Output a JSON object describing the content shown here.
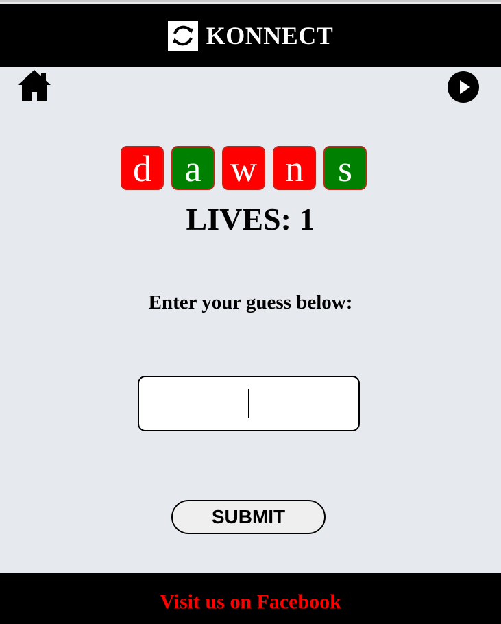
{
  "header": {
    "logo_icon": "refresh-arrows-icon",
    "title": "KONNECT"
  },
  "nav": {
    "home_icon": "home-icon",
    "play_icon": "play-circle-icon"
  },
  "game": {
    "letters": [
      {
        "char": "d",
        "status": "wrong",
        "color": "#ff0000"
      },
      {
        "char": "a",
        "status": "right",
        "color": "#008000"
      },
      {
        "char": "w",
        "status": "wrong",
        "color": "#ff0000"
      },
      {
        "char": "n",
        "status": "wrong",
        "color": "#ff0000"
      },
      {
        "char": "s",
        "status": "right",
        "color": "#008000"
      }
    ],
    "lives_text": "LIVES: 1",
    "prompt": "Enter your guess below:",
    "guess_value": "",
    "submit_label": "SUBMIT"
  },
  "footer": {
    "link_text": "Visit us on Facebook",
    "link_color": "#ff0000"
  }
}
